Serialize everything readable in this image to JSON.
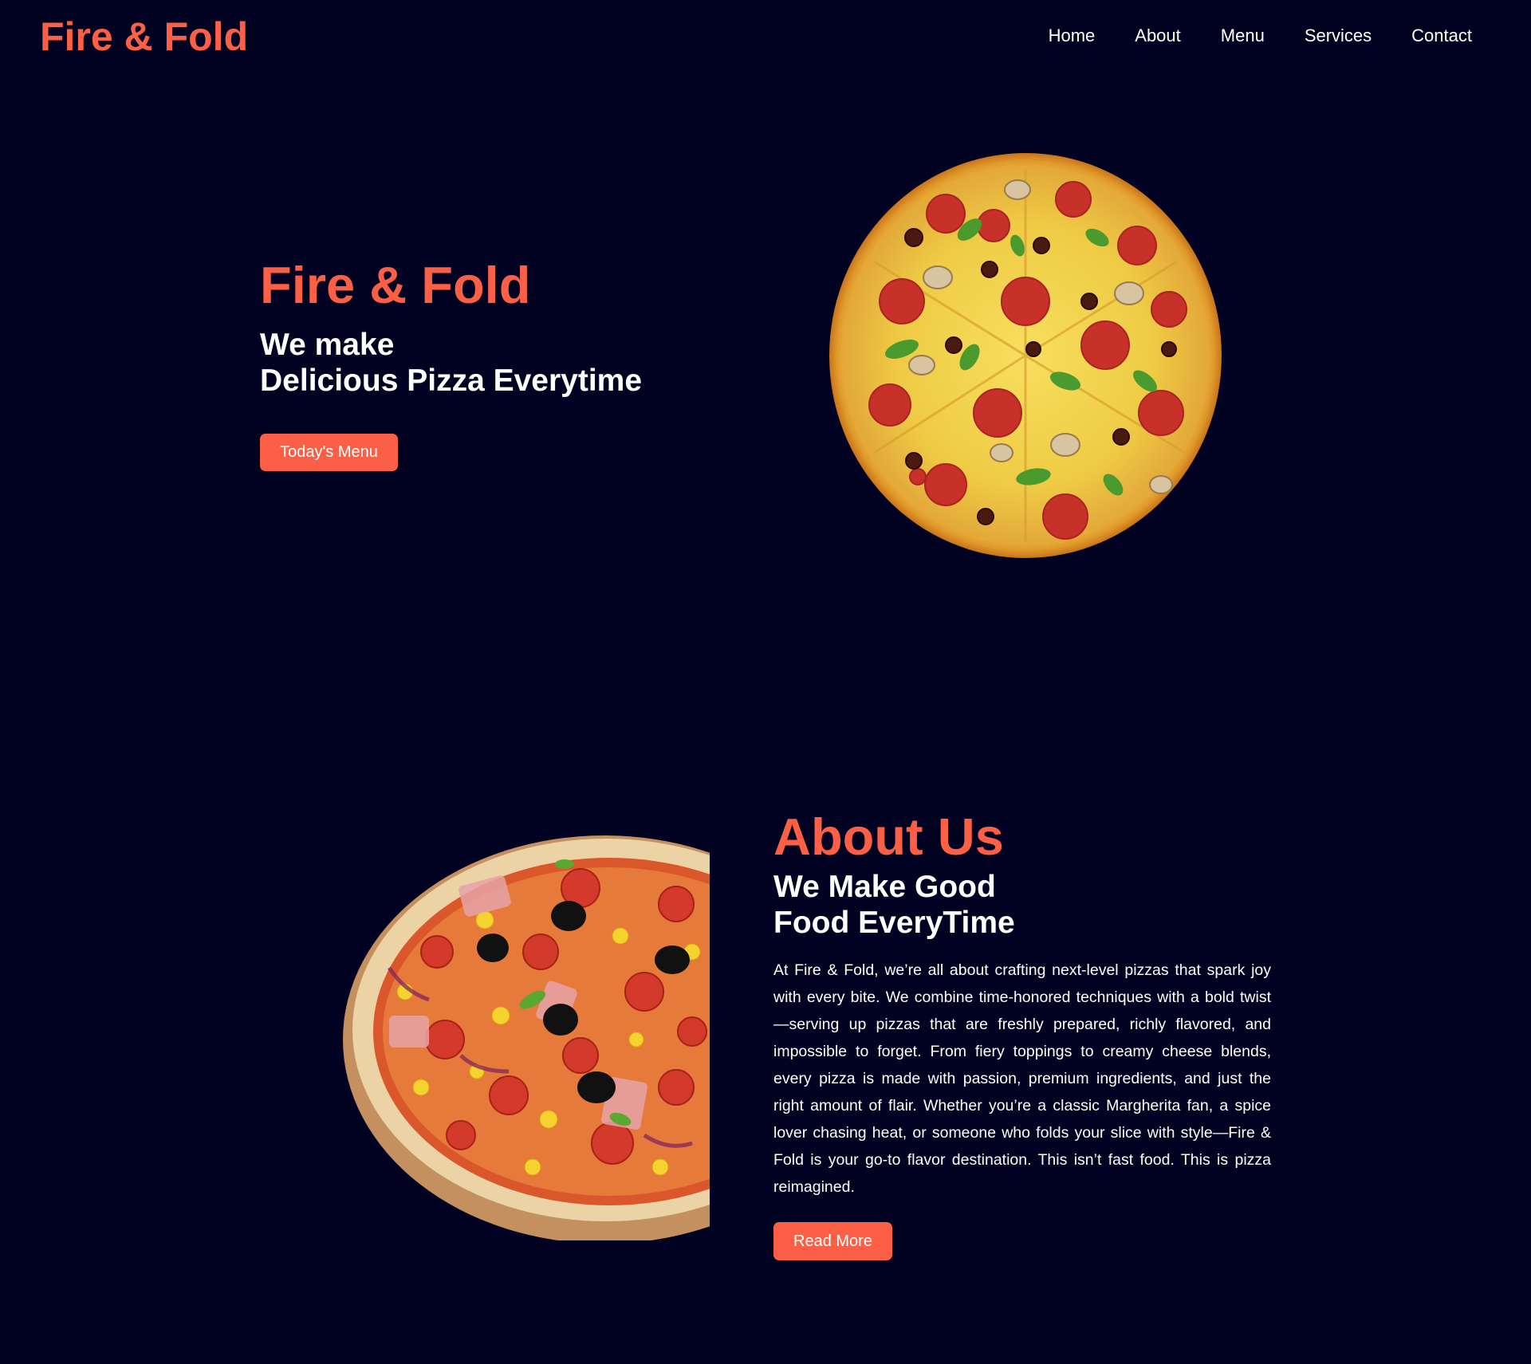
{
  "header": {
    "brand": "Fire & Fold",
    "nav": [
      "Home",
      "About",
      "Menu",
      "Services",
      "Contact"
    ]
  },
  "hero": {
    "title": "Fire & Fold",
    "subtitle_line1": "We make",
    "subtitle_line2": "Delicious Pizza Everytime",
    "button": "Today's Menu"
  },
  "about": {
    "title": "About Us",
    "subtitle_line1": "We Make Good",
    "subtitle_line2": "Food EveryTime",
    "body": "At Fire & Fold, we’re all about crafting next-level pizzas that spark joy with every bite. We combine time-honored techniques with a bold twist—serving up pizzas that are freshly prepared, richly flavored, and impossible to forget. From fiery toppings to creamy cheese blends, every pizza is made with passion, premium ingredients, and just the right amount of flair. Whether you’re a classic Margherita fan, a spice lover chasing heat, or someone who folds your slice with style—Fire & Fold is your go-to flavor destination. This isn’t fast food. This is pizza reimagined.",
    "button": "Read More"
  },
  "colors": {
    "background": "#010221",
    "accent": "#fb5f45",
    "text": "#ffffff"
  }
}
